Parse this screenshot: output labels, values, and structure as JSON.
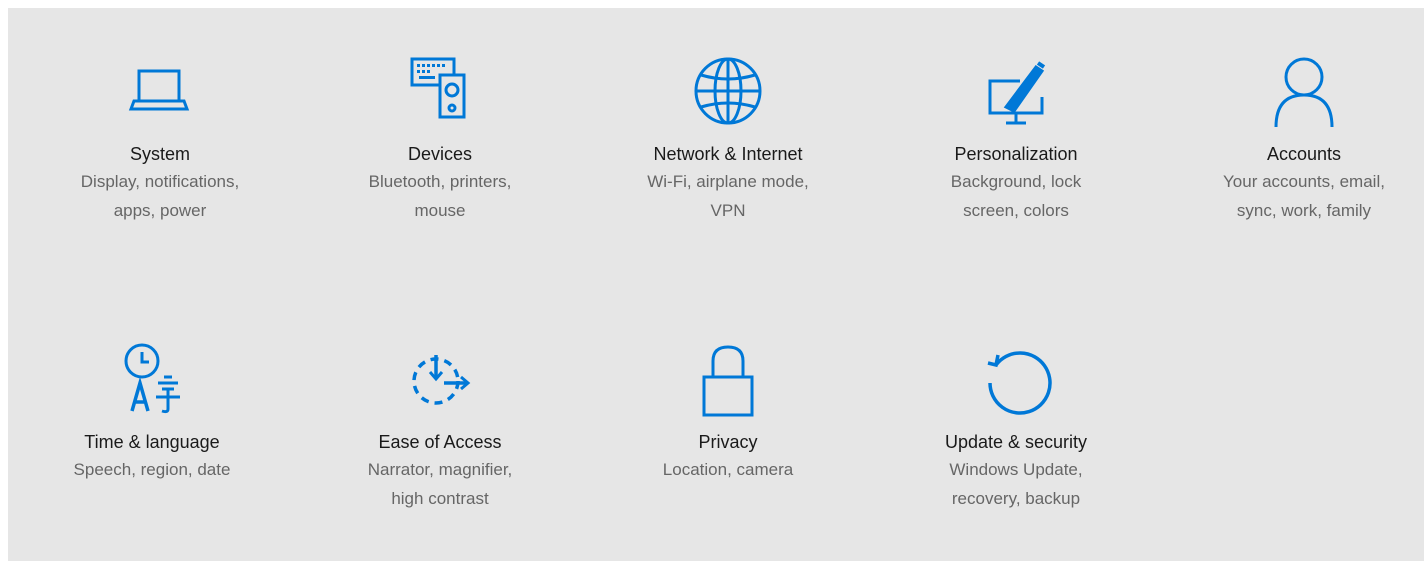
{
  "colors": {
    "accent": "#0078d7",
    "background": "#e6e6e6",
    "title_text": "#1a1a1a",
    "description_text": "#666666"
  },
  "tiles": [
    {
      "icon": "laptop-icon",
      "title": "System",
      "desc1": "Display, notifications,",
      "desc2": "apps, power"
    },
    {
      "icon": "keyboard-speaker-icon",
      "title": "Devices",
      "desc1": "Bluetooth, printers,",
      "desc2": "mouse"
    },
    {
      "icon": "globe-icon",
      "title": "Network & Internet",
      "desc1": "Wi-Fi, airplane mode,",
      "desc2": "VPN"
    },
    {
      "icon": "monitor-brush-icon",
      "title": "Personalization",
      "desc1": "Background, lock",
      "desc2": "screen, colors"
    },
    {
      "icon": "person-icon",
      "title": "Accounts",
      "desc1": "Your accounts, email,",
      "desc2": "sync, work, family"
    },
    {
      "icon": "clock-language-icon",
      "title": "Time & language",
      "desc1": "Speech, region, date",
      "desc2": ""
    },
    {
      "icon": "ease-of-access-icon",
      "title": "Ease of Access",
      "desc1": "Narrator, magnifier,",
      "desc2": "high contrast"
    },
    {
      "icon": "lock-icon",
      "title": "Privacy",
      "desc1": "Location, camera",
      "desc2": ""
    },
    {
      "icon": "sync-arrow-icon",
      "title": "Update & security",
      "desc1": "Windows Update,",
      "desc2": "recovery, backup"
    }
  ]
}
